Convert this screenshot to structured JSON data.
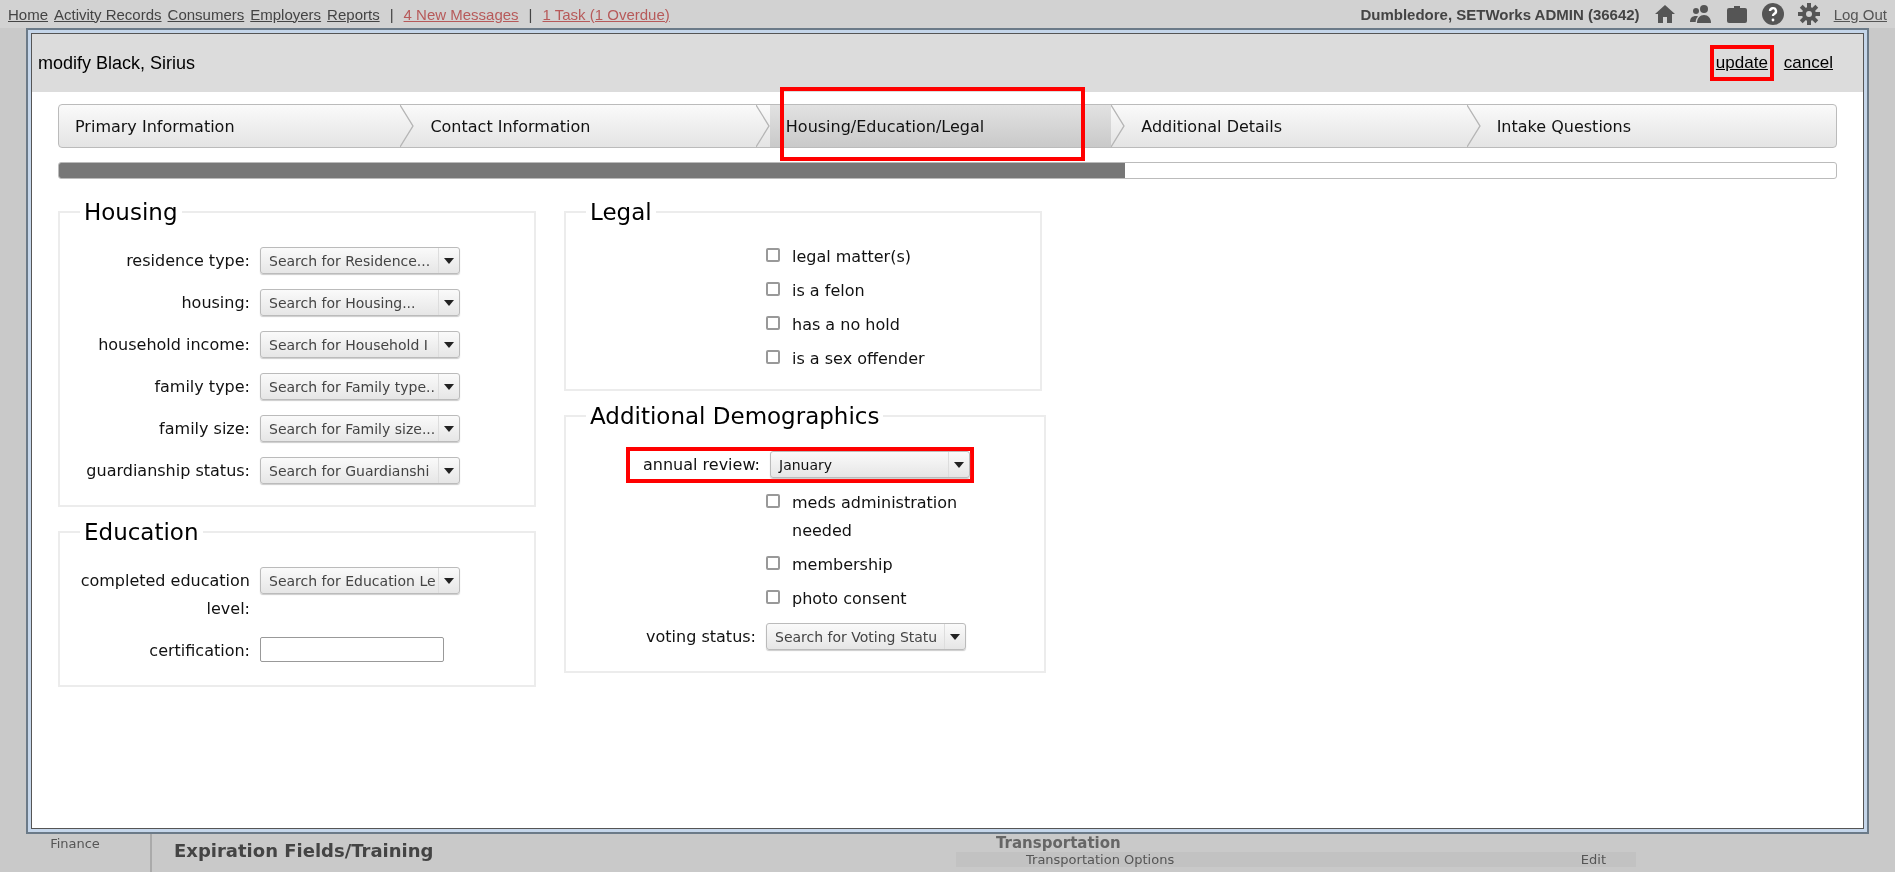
{
  "top_nav": {
    "links": [
      {
        "label": "Home"
      },
      {
        "label": "Activity Records"
      },
      {
        "label": "Consumers"
      },
      {
        "label": "Employers"
      },
      {
        "label": "Reports"
      }
    ],
    "alerts": [
      {
        "label": "4 New Messages"
      },
      {
        "label": "1 Task (1 Overdue)"
      }
    ],
    "separator": "|",
    "user": "Dumbledore, SETWorks ADMIN  (36642)",
    "logout": "Log Out"
  },
  "dialog": {
    "title": "modify Black, Sirius",
    "actions": [
      {
        "label": "update",
        "highlighted": true
      },
      {
        "label": "cancel",
        "highlighted": false
      }
    ],
    "steps": [
      {
        "label": "Primary Information",
        "selected": false,
        "highlighted": false
      },
      {
        "label": "Contact Information",
        "selected": false,
        "highlighted": false
      },
      {
        "label": "Housing/Education/Legal",
        "selected": true,
        "highlighted": true
      },
      {
        "label": "Additional Details",
        "selected": false,
        "highlighted": false
      },
      {
        "label": "Intake Questions",
        "selected": false,
        "highlighted": false
      }
    ],
    "progress": {
      "level": 0.6
    },
    "sections": [
      {
        "title": "Housing",
        "fields": [
          {
            "kind": "select",
            "label": "residence type:",
            "placeholder": "Search for Residence...",
            "highlighted": false
          },
          {
            "kind": "select",
            "label": "housing:",
            "placeholder": "Search for Housing...",
            "highlighted": false
          },
          {
            "kind": "select",
            "label": "household income:",
            "placeholder": "Search for Household I",
            "highlighted": false
          },
          {
            "kind": "select",
            "label": "family type:",
            "placeholder": "Search for Family type..",
            "highlighted": false
          },
          {
            "kind": "select",
            "label": "family size:",
            "placeholder": "Search for Family size...",
            "highlighted": false
          },
          {
            "kind": "select",
            "label": "guardianship status:",
            "placeholder": "Search for Guardianshi",
            "highlighted": false
          }
        ]
      },
      {
        "title": "Education",
        "fields": [
          {
            "kind": "select",
            "label": "completed education level:",
            "placeholder": "Search for Education Le",
            "highlighted": false
          },
          {
            "kind": "text",
            "label": "certification:",
            "highlighted": false
          }
        ]
      },
      {
        "title": "Legal",
        "fields": [
          {
            "kind": "checkbox",
            "label": "legal matter(s)",
            "checked": false
          },
          {
            "kind": "checkbox",
            "label": "is a felon",
            "checked": false
          },
          {
            "kind": "checkbox",
            "label": "has a no hold",
            "checked": false
          },
          {
            "kind": "checkbox",
            "label": "is a sex offender",
            "checked": false
          }
        ]
      },
      {
        "title": "Additional Demographics",
        "fields": [
          {
            "kind": "select",
            "label": "annual review:",
            "value": "January",
            "highlighted": true
          },
          {
            "kind": "checkbox",
            "label": "meds administration needed",
            "checked": false
          },
          {
            "kind": "checkbox",
            "label": "membership",
            "checked": false
          },
          {
            "kind": "checkbox",
            "label": "photo consent",
            "checked": false
          },
          {
            "kind": "select",
            "label": "voting status:",
            "placeholder": "Search for Voting Statu",
            "highlighted": false
          }
        ]
      }
    ]
  },
  "background": {
    "sidebar_item": "Finance",
    "section_title": "Expiration Fields/Training",
    "panel_title": "Transportation",
    "panel_row": "Transportation Options",
    "panel_action": "Edit"
  }
}
